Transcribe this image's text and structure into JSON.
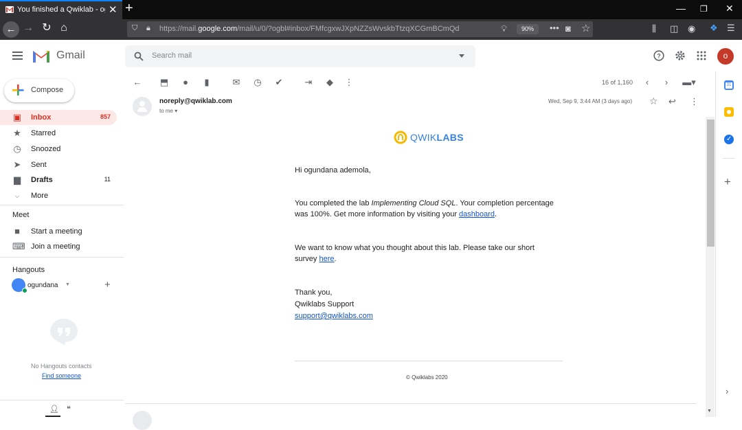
{
  "browser": {
    "tab_title": "You finished a Qwiklab - ogunda",
    "url_prefix": "https://mail.",
    "url_domain": "google.com",
    "url_rest": "/mail/u/0/?ogbl#inbox/FMfcgxwJXpNZZsWvskbTtzqXCGmBCmQd",
    "zoom": "90%"
  },
  "gmail": {
    "app_name": "Gmail",
    "search_placeholder": "Search mail",
    "avatar_letter": "o"
  },
  "sidebar": {
    "compose_label": "Compose",
    "items": [
      {
        "label": "Inbox",
        "count": "857"
      },
      {
        "label": "Starred",
        "count": ""
      },
      {
        "label": "Snoozed",
        "count": ""
      },
      {
        "label": "Sent",
        "count": ""
      },
      {
        "label": "Drafts",
        "count": "11"
      },
      {
        "label": "More",
        "count": ""
      }
    ],
    "meet_heading": "Meet",
    "meet_items": [
      {
        "label": "Start a meeting"
      },
      {
        "label": "Join a meeting"
      }
    ],
    "hangouts_heading": "Hangouts",
    "hangouts_user": "ogundana",
    "no_contacts": "No Hangouts contacts",
    "find_someone": "Find someone"
  },
  "toolbar": {
    "pager": "16 of 1,160"
  },
  "message": {
    "sender": "noreply@qwiklab.com",
    "to": "to me",
    "date": "Wed, Sep 9, 3:44 AM (3 days ago)",
    "brand_light": "QWIK",
    "brand_bold": "LABS",
    "greeting": "Hi ogundana ademola,",
    "p1_before": "You completed the lab ",
    "p1_italic": "Implementing Cloud SQL",
    "p1_after": ". Your completion percentage",
    "p1_line2": "was 100%. Get more information by visiting your ",
    "p1_link": "dashboard",
    "p2_line1": "We want to know what you thought about this lab. Please take our short",
    "p2_line2": "survey ",
    "p2_link": "here",
    "thanks": "Thank you,",
    "signature": "Qwiklabs Support",
    "support_email": "support@qwiklabs.com",
    "copyright": "© Qwiklabs 2020"
  },
  "colors": {
    "accent_red": "#d93025",
    "link_blue": "#1155cc",
    "qwiklabs_blue": "#3681e3",
    "qwiklabs_yellow": "#f6b900"
  }
}
